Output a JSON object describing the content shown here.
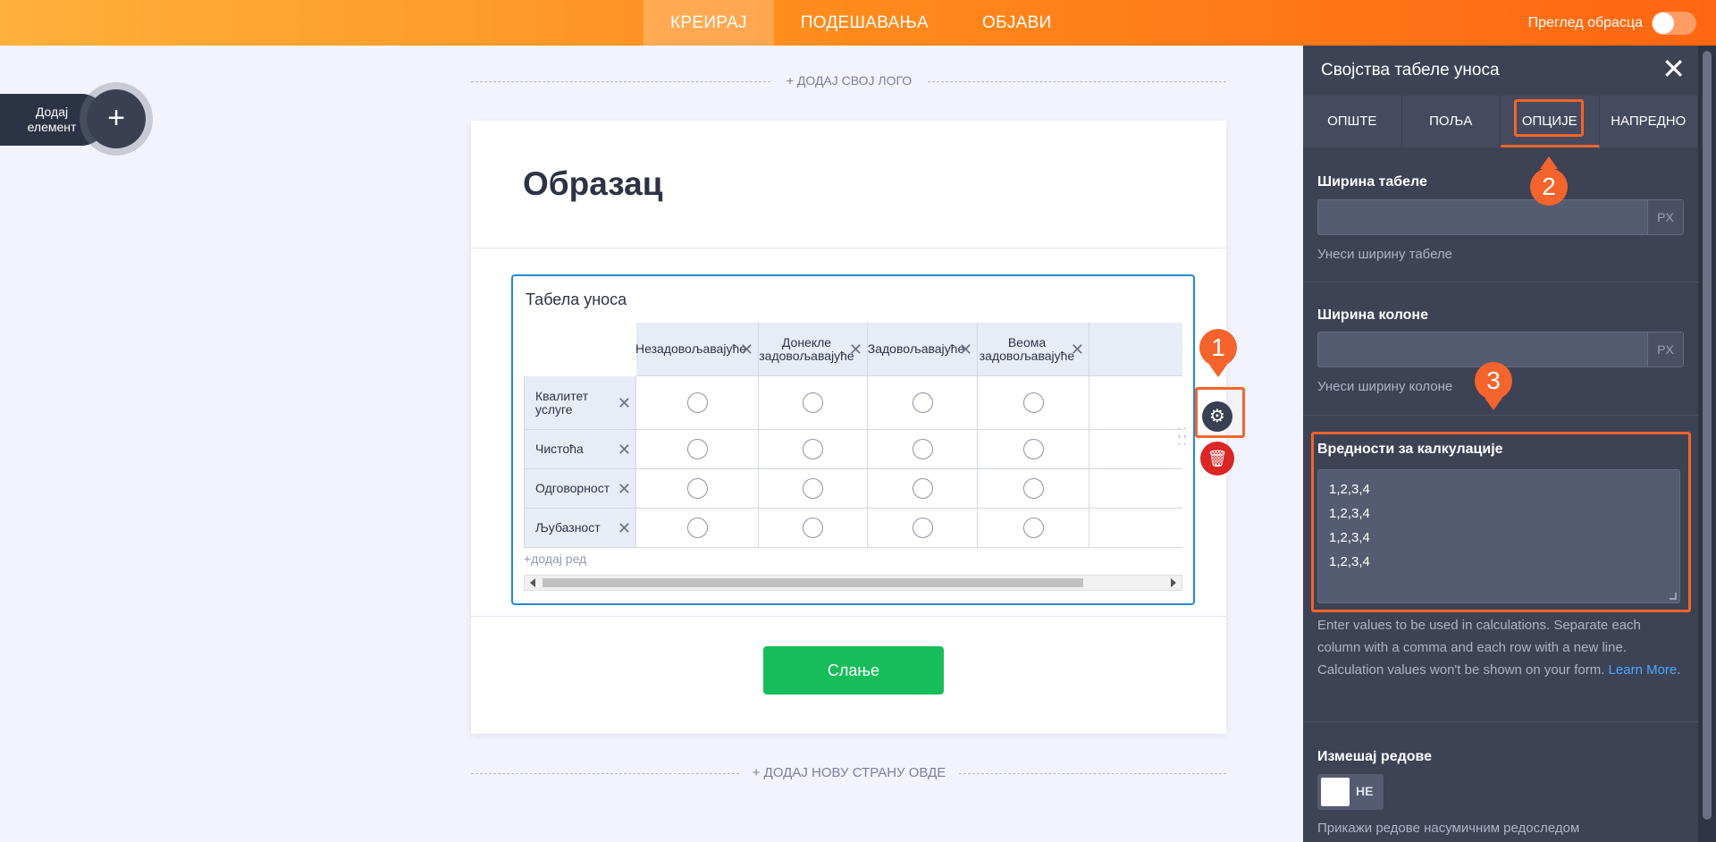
{
  "topnav": {
    "tabs": [
      {
        "label": "КРЕИРАЈ",
        "active": true
      },
      {
        "label": "ПОДЕШАВАЊА",
        "active": false
      },
      {
        "label": "ОБЈАВИ",
        "active": false
      }
    ],
    "preview_label": "Преглед обрасца"
  },
  "add_element": {
    "label": "Додај елемент",
    "icon": "plus-icon"
  },
  "builder": {
    "add_logo": "+ ДОДАЈ СВОЈ ЛОГО",
    "add_page": "+ ДОДАЈ НОВУ СТРАНУ ОВДЕ"
  },
  "form": {
    "title": "Образац",
    "submit_label": "Слање"
  },
  "matrix": {
    "label": "Табела уноса",
    "columns": [
      "Незадовољавајуће",
      "Донекле задовољавајуће",
      "Задовољавајуће",
      "Веома задовољавајуће"
    ],
    "rows": [
      "Квалитет услуге",
      "Чистоћа",
      "Одговорност",
      "Љубазност"
    ],
    "add_row": "+додај ред"
  },
  "annotations": {
    "badge1": "1",
    "badge2": "2",
    "badge3": "3",
    "color": "#f4642c"
  },
  "panel": {
    "title": "Својства табеле уноса",
    "tabs": [
      {
        "label": "ОПШТЕ",
        "active": false
      },
      {
        "label": "ПОЉА",
        "active": false
      },
      {
        "label": "ОПЦИЈЕ",
        "active": true
      },
      {
        "label": "НАПРЕДНО",
        "active": false
      }
    ],
    "table_width": {
      "title": "Ширина табеле",
      "value": "",
      "suffix": "PX",
      "help": "Унеси ширину табеле"
    },
    "column_width": {
      "title": "Ширина колоне",
      "value": "",
      "suffix": "PX",
      "help": "Унеси ширину колоне"
    },
    "calc_values": {
      "title": "Вредности за калкулације",
      "lines": [
        "1,2,3,4",
        "1,2,3,4",
        "1,2,3,4",
        "1,2,3,4"
      ],
      "help": "Enter values to be used in calculations. Separate each column with a comma and each row with a new line. Calculation values won't be shown on your form. ",
      "learn_more": "Learn More",
      "help_end": "."
    },
    "shuffle_rows": {
      "title": "Измешај редове",
      "toggle": "НЕ",
      "help": "Прикажи редове насумичним редоследом"
    }
  },
  "colors": {
    "brand_orange": "#ff8a1c",
    "submit_green": "#18bd5b",
    "panel_bg": "#3d4255",
    "accent_blue": "#1f8ad1"
  }
}
